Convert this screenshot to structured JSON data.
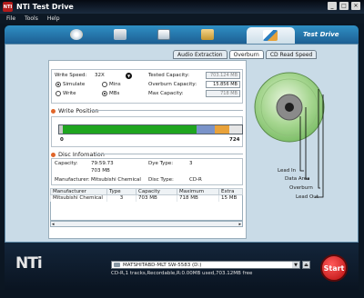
{
  "window": {
    "title": "NTi Test Drive",
    "app_icon": "NTI",
    "controls": [
      "_",
      "□",
      "✕"
    ]
  },
  "menu": [
    "File",
    "Tools",
    "Help"
  ],
  "toolbar": {
    "active_label": "Test Drive",
    "icons": [
      "disc-burn-icon",
      "tools-icon",
      "document-icon",
      "folder-copy-icon",
      "test-drive-icon"
    ]
  },
  "subtabs": [
    "Audio Extraction",
    "Overburn",
    "CD Read Speed"
  ],
  "settings": {
    "write_speed_label": "Write Speed:",
    "write_speed_value": "32X",
    "options": [
      "Simulate",
      "Mins",
      "Write",
      "MBs"
    ],
    "tested_capacity_label": "Tested Capacity:",
    "tested_capacity_value": "703.124 MB",
    "overburn_capacity_label": "Overburn Capacity:",
    "overburn_capacity_value": "15.856 MB",
    "max_capacity_label": "Max Capacity:",
    "max_capacity_value": "718 MB"
  },
  "write_position": {
    "title": "Write Position",
    "start_label": "0",
    "end_label": "724",
    "segments": {
      "lead_in": 0.02,
      "data": 0.73,
      "overburn": 0.1,
      "lead_out": 0.08
    }
  },
  "disc_info": {
    "title": "Disc Infomation",
    "capacity_label": "Capacity:",
    "capacity_values": [
      "79:59.73",
      "703 MB"
    ],
    "dye_type_label": "Dye Type:",
    "dye_type_value": "3",
    "manufacturer_label": "Manufacturer:",
    "manufacturer_value": "Mitsubishi Chemical",
    "disc_type_label": "Disc Type:",
    "disc_type_value": "CD-R"
  },
  "table": {
    "headers": [
      "Manufacturer",
      "Type",
      "Capacity",
      "Maximum",
      "Extra"
    ],
    "rows": [
      [
        "Mitsubishi Chemical",
        "3",
        "703 MB",
        "718 MB",
        "15 MB"
      ]
    ]
  },
  "disc_labels": [
    "Lead In",
    "Data Area",
    "Overburn",
    "Lead Out"
  ],
  "colors": {
    "green": "#1fa51f",
    "blue": "#7a93c9",
    "orange": "#e9a23a",
    "gray": "#c8c8c8"
  },
  "footer": {
    "logo": "NTi",
    "drive": "MATSHITABD-MLT SW-5583 (D:)",
    "status": "CD-R,1 tracks,Recordable,R:0.00MB used,703.12MB free",
    "start_label": "Start"
  }
}
